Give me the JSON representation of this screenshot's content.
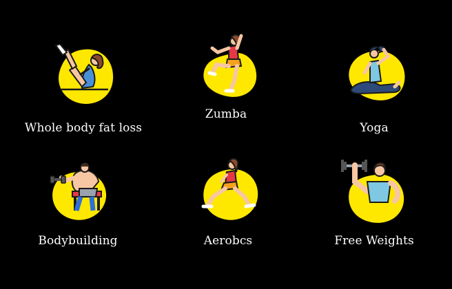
{
  "activities": [
    {
      "label": "Whole body fat loss",
      "icon": "situp-icon"
    },
    {
      "label": "Zumba",
      "icon": "zumba-dancer-icon"
    },
    {
      "label": "Yoga",
      "icon": "yoga-pose-icon"
    },
    {
      "label": "Bodybuilding",
      "icon": "dumbbell-curl-icon"
    },
    {
      "label": "Aerobcs",
      "icon": "lunge-icon"
    },
    {
      "label": "Free Weights",
      "icon": "weightlifter-icon"
    }
  ],
  "colors": {
    "background": "#000000",
    "blob": "#FFE800",
    "text": "#FFFFFF",
    "skin": "#F7C6A3",
    "outline": "#1A1A1A"
  }
}
